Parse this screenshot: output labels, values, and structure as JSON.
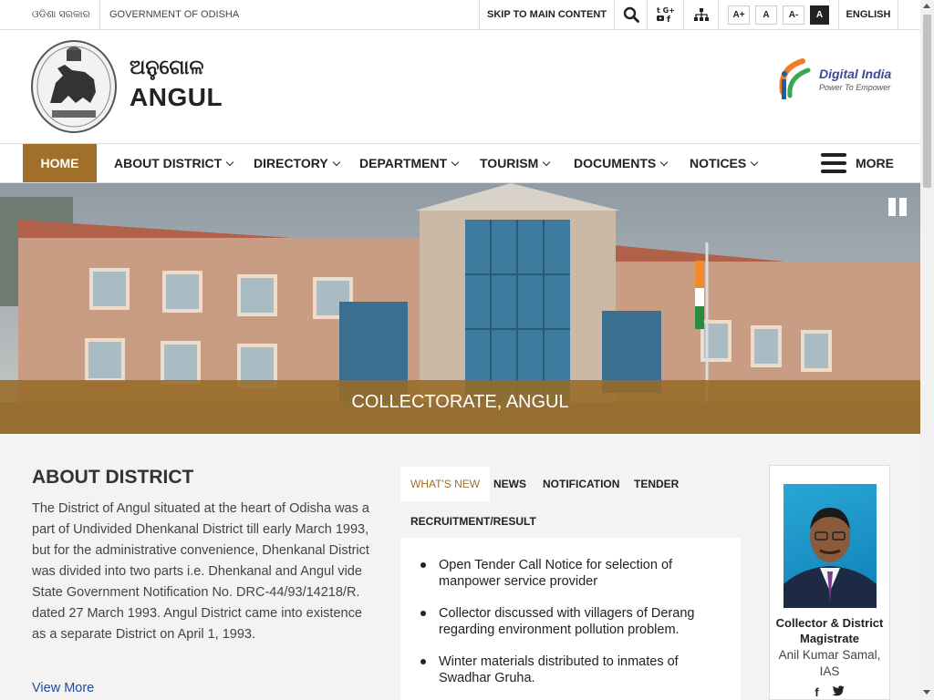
{
  "topbar": {
    "odia_govt": "ଓଡିଶା ସରକାର",
    "government": "GOVERNMENT OF ODISHA",
    "skip": "SKIP TO MAIN CONTENT",
    "font_sizes": [
      "A+",
      "A",
      "A-",
      "A"
    ],
    "language": "ENGLISH",
    "icons": [
      "search-icon",
      "social-media-icon",
      "sitemap-icon"
    ]
  },
  "header": {
    "title_odia": "ଅନୁଗୋଳ",
    "title": "ANGUL",
    "digital_india": {
      "title": "Digital India",
      "subtitle": "Power To Empower"
    }
  },
  "nav": {
    "home": "HOME",
    "items": [
      "ABOUT DISTRICT",
      "DIRECTORY",
      "DEPARTMENT",
      "TOURISM",
      "DOCUMENTS",
      "NOTICES"
    ],
    "more": "MORE"
  },
  "banner": {
    "caption": "COLLECTORATE, ANGUL"
  },
  "about": {
    "title": "ABOUT DISTRICT",
    "text": "The District of Angul situated at the heart of Odisha was a part of Undivided Dhenkanal District till early March 1993, but for the administrative convenience, Dhenkanal District was divided into two parts i.e. Dhenkanal and Angul vide State Government Notification No. DRC-44/93/14218/R. dated 27 March 1993. Angul District came into existence as a separate District on April 1, 1993.",
    "view_more": "View More"
  },
  "tabs": {
    "labels": [
      "WHAT'S NEW",
      "NEWS",
      "NOTIFICATION",
      "TENDER",
      "RECRUITMENT/RESULT"
    ],
    "active": "WHAT'S NEW",
    "items": [
      "Open Tender Call Notice for selection of manpower service provider",
      "Collector discussed with villagers of Derang regarding environment pollution problem.",
      "Winter materials distributed to inmates of Swadhar Gruha."
    ]
  },
  "profile": {
    "role": "Collector & District Magistrate",
    "name": "Anil Kumar Samal, IAS",
    "social": [
      "facebook-icon",
      "twitter-icon"
    ]
  },
  "colors": {
    "accent": "#a0702b",
    "link": "#1a4fa0"
  }
}
